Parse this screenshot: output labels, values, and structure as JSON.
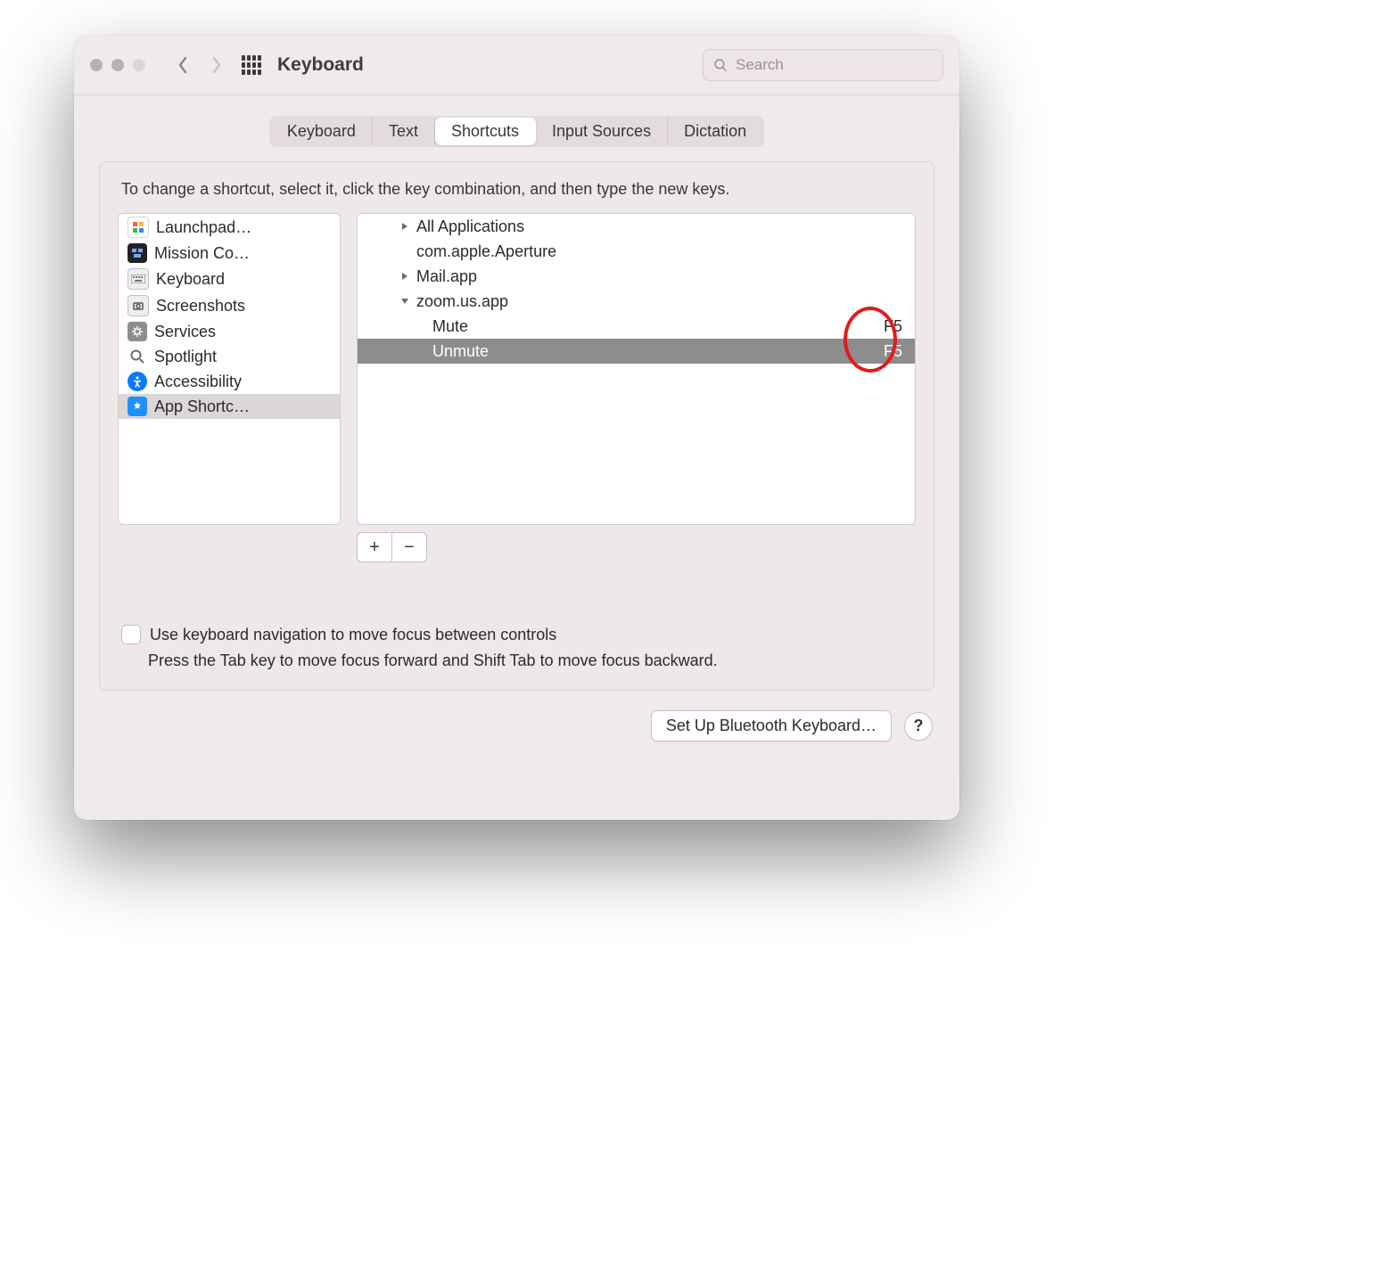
{
  "window": {
    "title": "Keyboard"
  },
  "search": {
    "placeholder": "Search"
  },
  "tabs": [
    "Keyboard",
    "Text",
    "Shortcuts",
    "Input Sources",
    "Dictation"
  ],
  "active_tab_index": 2,
  "hint": "To change a shortcut, select it, click the key combination, and then type the new keys.",
  "categories": [
    {
      "label": "Launchpad…",
      "icon": "launchpad"
    },
    {
      "label": "Mission Co…",
      "icon": "mission"
    },
    {
      "label": "Keyboard",
      "icon": "keyboard"
    },
    {
      "label": "Screenshots",
      "icon": "screenshots"
    },
    {
      "label": "Services",
      "icon": "services"
    },
    {
      "label": "Spotlight",
      "icon": "spotlight"
    },
    {
      "label": "Accessibility",
      "icon": "accessibility"
    },
    {
      "label": "App Shortc…",
      "icon": "appstore"
    }
  ],
  "selected_category_index": 7,
  "outline": [
    {
      "level": 0,
      "expanded": false,
      "label": "All Applications",
      "shortcut": ""
    },
    {
      "level": 1,
      "leaf": true,
      "label": "com.apple.Aperture",
      "shortcut": ""
    },
    {
      "level": 0,
      "expanded": false,
      "label": "Mail.app",
      "shortcut": ""
    },
    {
      "level": 0,
      "expanded": true,
      "label": "zoom.us.app",
      "shortcut": ""
    },
    {
      "level": 1,
      "leaf": true,
      "label": "Mute",
      "shortcut": "F5"
    },
    {
      "level": 1,
      "leaf": true,
      "label": "Unmute",
      "shortcut": "F5",
      "selected": true
    }
  ],
  "checkbox": {
    "label": "Use keyboard navigation to move focus between controls",
    "sub": "Press the Tab key to move focus forward and Shift Tab to move focus backward."
  },
  "footer": {
    "setup": "Set Up Bluetooth Keyboard…",
    "help": "?"
  },
  "buttons": {
    "plus": "+",
    "minus": "−"
  }
}
